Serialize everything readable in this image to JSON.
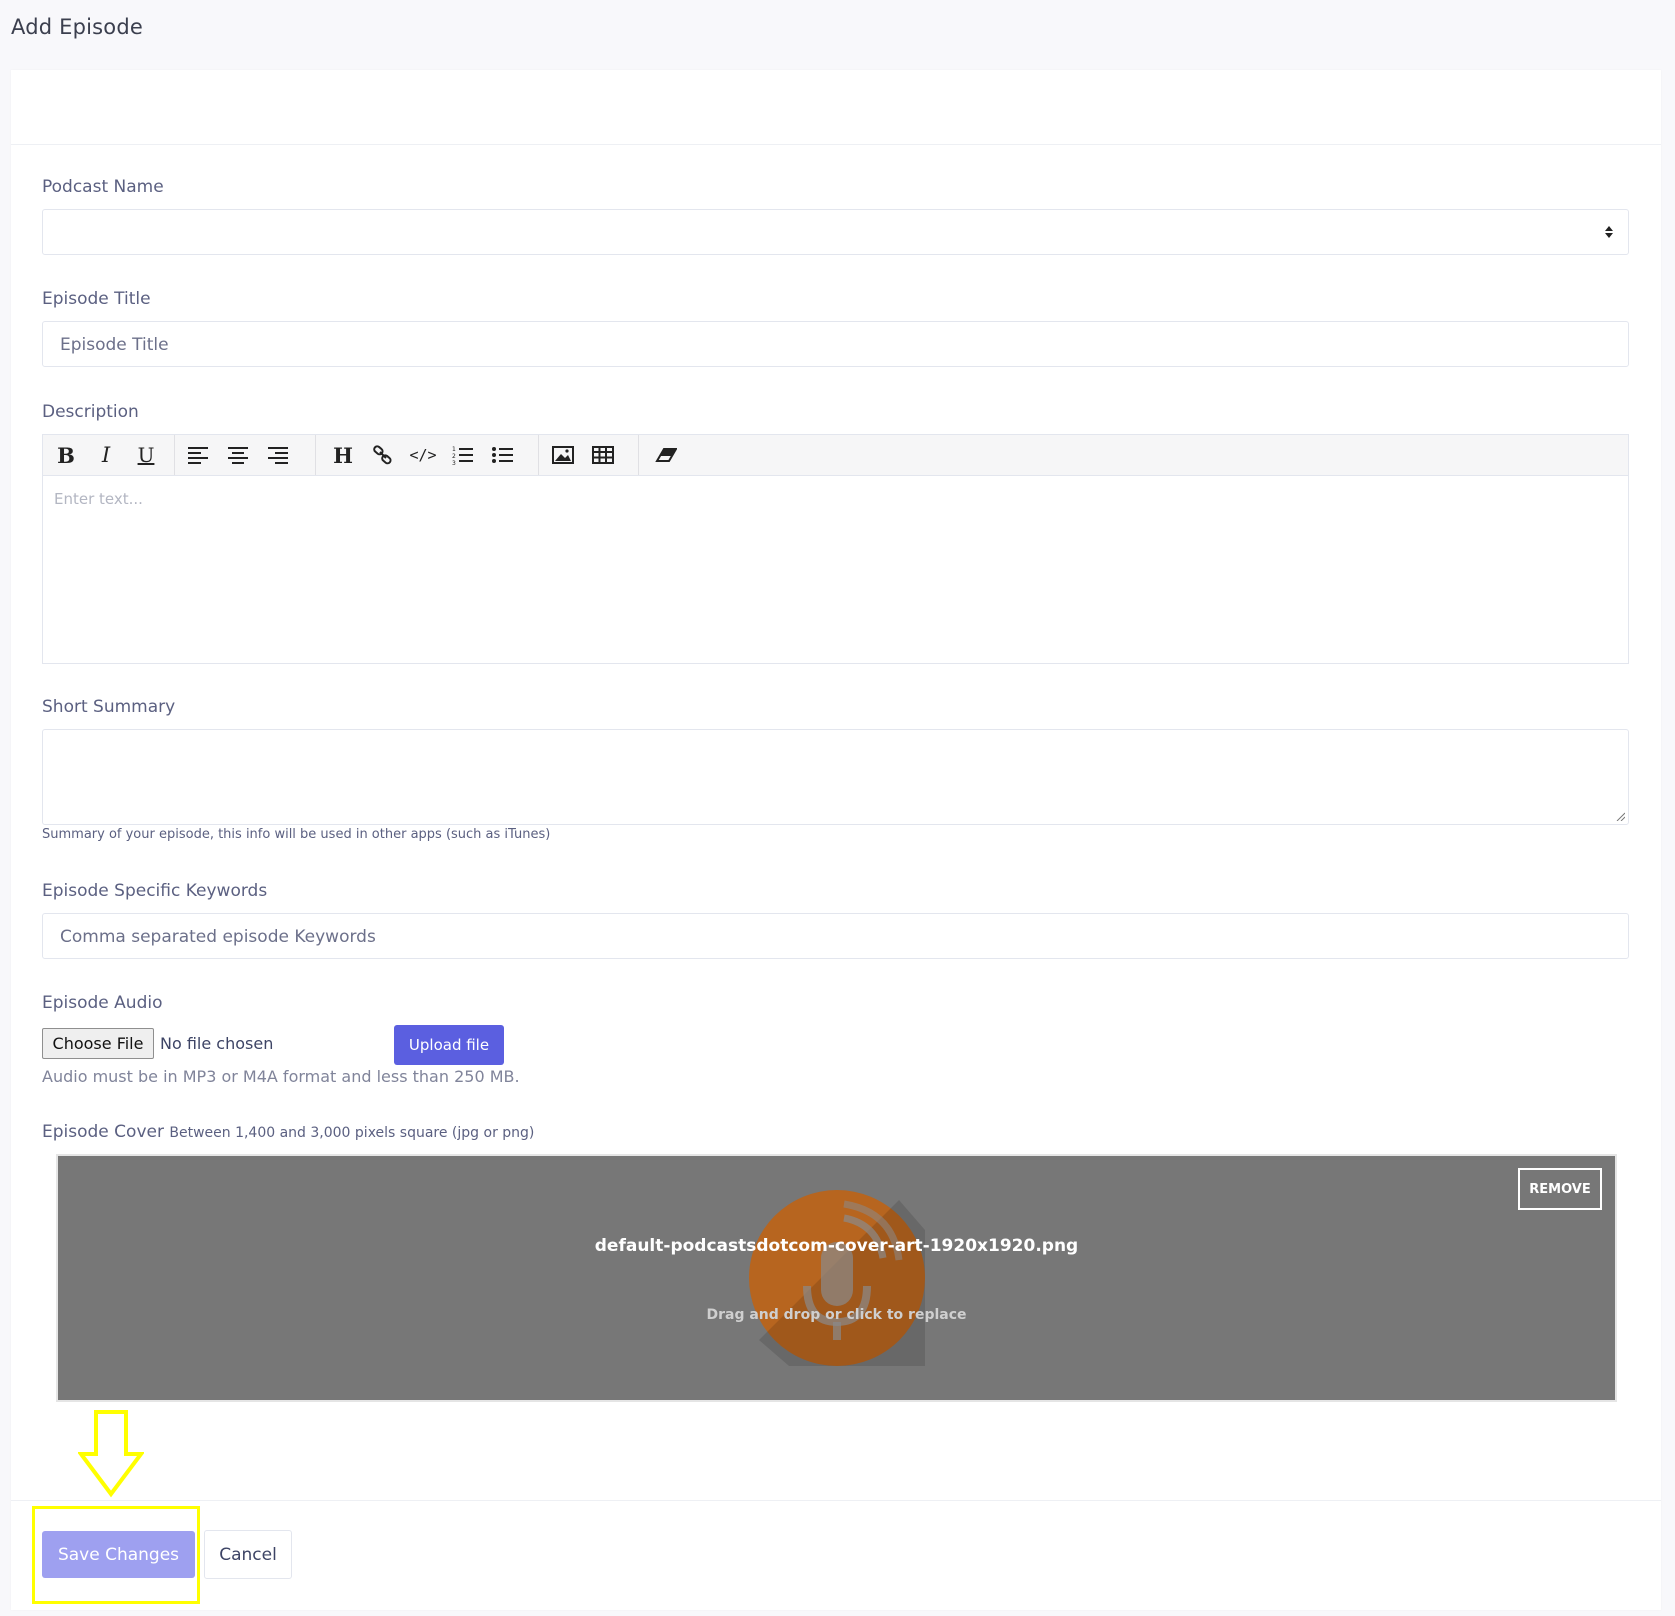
{
  "page": {
    "title": "Add Episode"
  },
  "form": {
    "podcast_name": {
      "label": "Podcast Name",
      "value": ""
    },
    "episode_title": {
      "label": "Episode Title",
      "placeholder": "Episode Title"
    },
    "description": {
      "label": "Description",
      "placeholder": "Enter text...",
      "toolbar": {
        "bold": "B",
        "italic": "I",
        "underline": "U",
        "heading": "H",
        "code": "</>"
      }
    },
    "short_summary": {
      "label": "Short Summary",
      "hint": "Summary of your episode, this info will be used in other apps (such as iTunes)"
    },
    "keywords": {
      "label": "Episode Specific Keywords",
      "placeholder": "Comma separated episode Keywords"
    },
    "audio": {
      "label": "Episode Audio",
      "choose_file": "Choose File",
      "no_file": "No file chosen",
      "upload": "Upload file",
      "hint": "Audio must be in MP3 or M4A format and less than 250 MB."
    },
    "cover": {
      "label": "Episode Cover",
      "hint": "Between 1,400 and 3,000 pixels square (jpg or png)",
      "file_name": "default-podcastsdotcom-cover-art-1920x1920.png",
      "replace_message": "Drag and drop or click to replace",
      "remove": "REMOVE"
    }
  },
  "actions": {
    "save": "Save Changes",
    "cancel": "Cancel"
  },
  "colors": {
    "primary": "#5b5fe0",
    "primary_disabled": "#9ea0f0",
    "annotation": "#ffff00",
    "cover_orange": "#c2620f"
  }
}
